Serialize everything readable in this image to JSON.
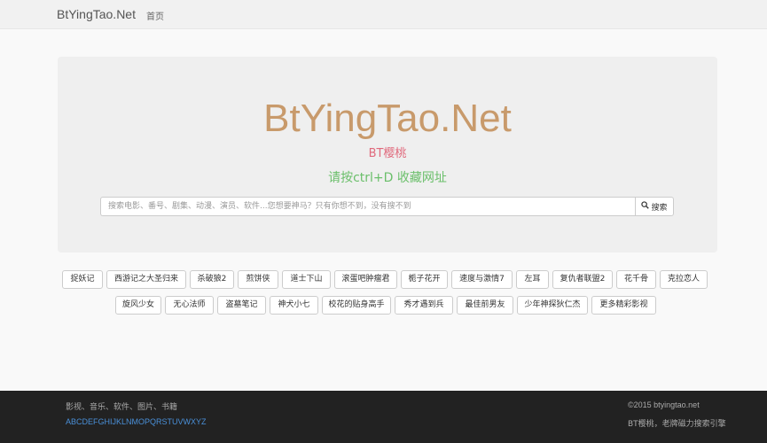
{
  "navbar": {
    "brand": "BtYingTao.Net",
    "home": "首页"
  },
  "hero": {
    "title": "BtYingTao.Net",
    "subtitle": "BT樱桃",
    "tip": "请按ctrl+D 收藏网址"
  },
  "search": {
    "placeholder": "搜索电影、番号、剧集、动漫、演员、软件...您想要神马？只有你想不到，没有搜不到",
    "button_label": "搜索"
  },
  "tags": {
    "row1": [
      "捉妖记",
      "西游记之大圣归来",
      "杀破狼2",
      "煎饼侠",
      "道士下山",
      "滚蛋吧肿瘤君",
      "栀子花开",
      "速度与激情7",
      "左耳",
      "复仇者联盟2",
      "花千骨",
      "克拉恋人"
    ],
    "row2": [
      "旋风少女",
      "无心法师",
      "盗墓笔记",
      "神犬小七",
      "校花的贴身高手",
      "秀才遇到兵",
      "最佳前男友",
      "少年神探狄仁杰",
      "更多精彩影视"
    ]
  },
  "footer": {
    "categories": "影视、音乐、软件、图片、书籍",
    "alphabet": "ABCDEFGHIJKLNMOPQRSTUVWXYZ",
    "copyright": "©2015 btyingtao.net",
    "slogan": "BT樱桃，老牌磁力搜索引擎"
  },
  "colors": {
    "title": "#c89a6b",
    "subtitle": "#e0697c",
    "tip": "#6bbf6b",
    "footer_bg": "#222222",
    "alphabet_link": "#4a90d9"
  }
}
